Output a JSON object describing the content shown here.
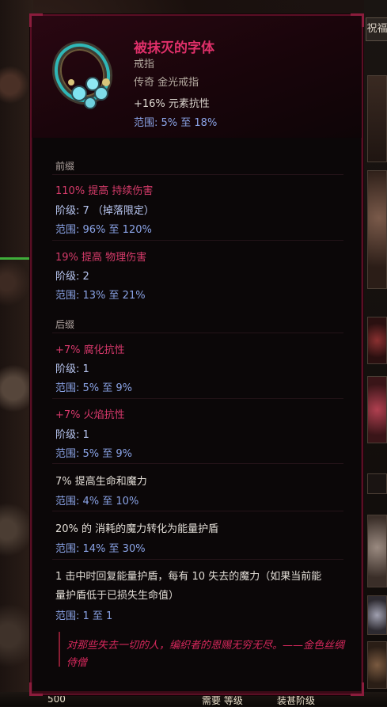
{
  "item": {
    "name": "被抹灭的字体",
    "base_type": "戒指",
    "rarity_line": "传奇 金光戒指",
    "implicit": "+16% 元素抗性",
    "implicit_range": "范围: 5% 至 18%"
  },
  "prefixes": {
    "header": "前缀",
    "mods": [
      {
        "text": "110% 提高 持续伤害",
        "tier": "阶级: 7 （掉落限定）",
        "range": "范围: 96% 至 120%"
      },
      {
        "text": "19% 提高 物理伤害",
        "tier": "阶级: 2",
        "range": "范围: 13% 至 21%"
      }
    ]
  },
  "suffixes": {
    "header": "后缀",
    "mods": [
      {
        "text": "+7% 腐化抗性",
        "tier": "阶级: 1",
        "range": "范围: 5% 至 9%"
      },
      {
        "text": "+7% 火焰抗性",
        "tier": "阶级: 1",
        "range": "范围: 5% 至 9%"
      }
    ]
  },
  "unique_mods": [
    {
      "text": "7% 提高生命和魔力",
      "range": "范围: 4% 至 10%"
    },
    {
      "text": "20% 的 消耗的魔力转化为能量护盾",
      "range": "范围: 14% 至 30%"
    },
    {
      "text_line1": "1 击中时回复能量护盾，每有 10 失去的魔力（如果当前能",
      "text_line2": "量护盾低于已损失生命值）",
      "range": "范围: 1 至 1"
    }
  ],
  "lore": {
    "line1": "对那些失去一切的人，编织者的恩赐无穷无尽。——金色丝绸",
    "line2": "侍僧"
  },
  "right_tab": "祝福",
  "hud": {
    "gold": "500",
    "mid": "需要 等级",
    "right": "装甚阶级"
  },
  "colors": {
    "unique_name": "#e0306a",
    "range_blue": "#8aa3e6",
    "border": "#5a0e24"
  }
}
